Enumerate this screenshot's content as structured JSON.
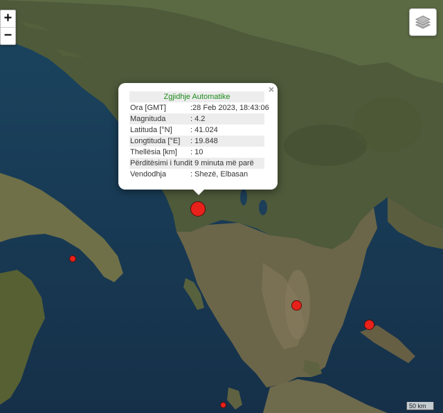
{
  "popup": {
    "title": "Zgjidhje Automatike",
    "close": "×",
    "rows": [
      {
        "label": "Ora [GMT]",
        "value": ":28 Feb 2023, 18:43:06"
      },
      {
        "label": "Magnituda",
        "value": ": 4.2"
      },
      {
        "label": "Latituda [°N]",
        "value": ": 41.024"
      },
      {
        "label": "Longtituda [°E]",
        "value": ": 19.848"
      },
      {
        "label": "Thellësia [km]",
        "value": ": 10"
      },
      {
        "label": "Përditësimi i fundit",
        "value": ": 9 minuta më parë"
      },
      {
        "label": "Vendodhja",
        "value": ": Shezë, Elbasan"
      }
    ]
  },
  "controls": {
    "zoom_in": "+",
    "zoom_out": "−",
    "layers_icon": "layers-icon"
  },
  "scale_bar": "50 km",
  "colors": {
    "quake_marker": "#e8211b",
    "popup_title": "#1c8a1c",
    "sea": "#17384f"
  }
}
